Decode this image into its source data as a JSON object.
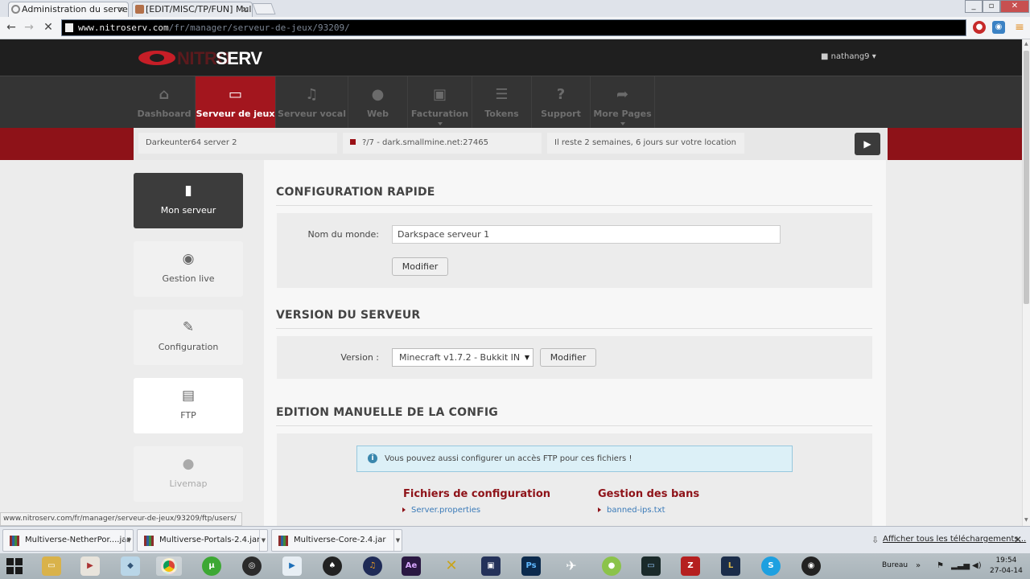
{
  "browser": {
    "tabs": [
      {
        "title": "Administration du serveu",
        "close": "×"
      },
      {
        "title": "[EDIT/MISC/TP/FUN] Mul",
        "close": "×"
      }
    ],
    "url_host": "www.nitroserv.com",
    "url_path": "/fr/manager/serveur-de-jeux/93209/",
    "status_url": "www.nitroserv.com/fr/manager/serveur-de-jeux/93209/ftp/users/"
  },
  "site": {
    "logo_part1": "NITRO",
    "logo_part2": "SERV",
    "user": "nathang9"
  },
  "nav": [
    {
      "label": "Dashboard",
      "icon": "home-icon"
    },
    {
      "label": "Serveur de jeux",
      "icon": "hdd-icon"
    },
    {
      "label": "Serveur vocal",
      "icon": "headphones-icon"
    },
    {
      "label": "Web",
      "icon": "globe-icon"
    },
    {
      "label": "Facturation",
      "icon": "money-icon"
    },
    {
      "label": "Tokens",
      "icon": "list-icon"
    },
    {
      "label": "Support",
      "icon": "question-icon"
    },
    {
      "label": "More Pages",
      "icon": "share-icon"
    }
  ],
  "infobar": {
    "server_name": "Darkeunter64 server 2",
    "server_address": "?/7 - dark.smallmine.net:27465",
    "rental_remaining": "Il reste 2 semaines, 6 jours sur votre location"
  },
  "sidebar": [
    {
      "label": "Mon serveur",
      "icon": "bookmark-icon"
    },
    {
      "label": "Gestion live",
      "icon": "play-circle-icon"
    },
    {
      "label": "Configuration",
      "icon": "wrench-icon"
    },
    {
      "label": "FTP",
      "icon": "file-icon"
    },
    {
      "label": "Livemap",
      "icon": "globe-icon"
    }
  ],
  "quick_config": {
    "title": "CONFIGURATION RAPIDE",
    "world_label": "Nom du monde:",
    "world_value": "Darkspace serveur 1",
    "submit": "Modifier"
  },
  "server_version": {
    "title": "VERSION DU SERVEUR",
    "label": "Version :",
    "selected": "Minecraft v1.7.2 - Bukkit IN",
    "submit": "Modifier"
  },
  "manual_config": {
    "title": "EDITION MANUELLE DE LA CONFIG",
    "notice": "Vous pouvez aussi configurer un accès FTP pour ces fichiers !",
    "config_files_title": "Fichiers de configuration",
    "config_files": [
      "Server.properties"
    ],
    "bans_title": "Gestion des bans",
    "bans_files": [
      "banned-ips.txt"
    ]
  },
  "downloads": {
    "items": [
      "Multiverse-NetherPor....jar",
      "Multiverse-Portals-2.4.jar",
      "Multiverse-Core-2.4.jar"
    ],
    "show_all": "Afficher tous les téléchargements..."
  },
  "taskbar": {
    "bureau": "Bureau",
    "time": "19:54",
    "date": "27-04-14"
  }
}
